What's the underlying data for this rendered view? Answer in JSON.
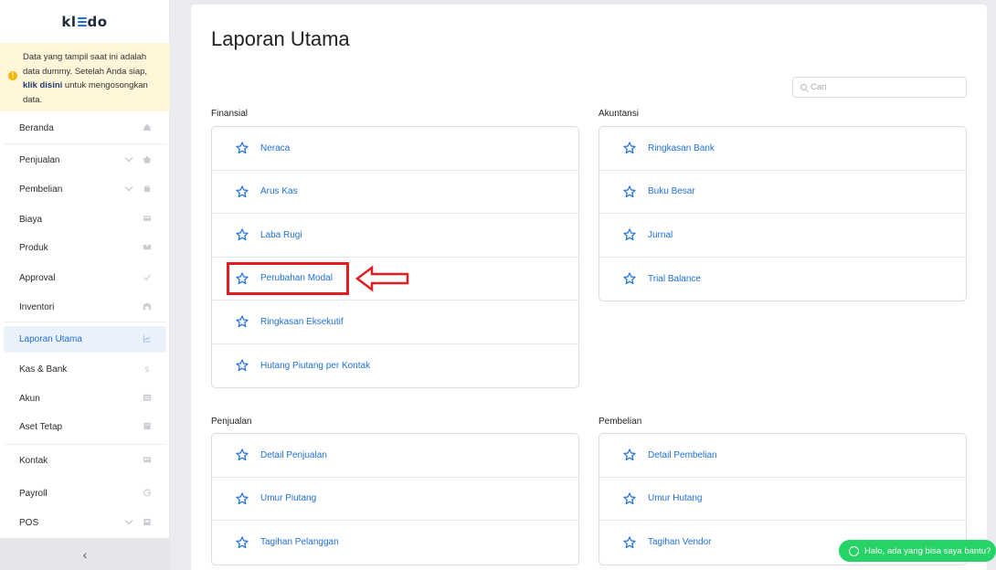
{
  "app": {
    "logo": "kledo"
  },
  "notice": {
    "line1": "Data yang tampil saat ini adalah data dummy. Setelah Anda siap, ",
    "link": "klik disini",
    "line2": " untuk mengosongkan data."
  },
  "sidebar": {
    "items": [
      {
        "label": "Beranda",
        "icon": "home-icon"
      },
      {
        "label": "Penjualan",
        "icon": "basket-icon",
        "expandable": true
      },
      {
        "label": "Pembelian",
        "icon": "bag-icon",
        "expandable": true
      },
      {
        "label": "Biaya",
        "icon": "card-icon"
      },
      {
        "label": "Produk",
        "icon": "box-icon"
      },
      {
        "label": "Approval",
        "icon": "check-icon"
      },
      {
        "label": "Inventori",
        "icon": "warehouse-icon"
      },
      {
        "label": "Laporan Utama",
        "icon": "chart-icon",
        "active": true
      },
      {
        "label": "Kas & Bank",
        "icon": "dollar-icon"
      },
      {
        "label": "Akun",
        "icon": "ledger-icon"
      },
      {
        "label": "Aset Tetap",
        "icon": "building-icon"
      },
      {
        "label": "Kontak",
        "icon": "contact-card-icon"
      },
      {
        "label": "Payroll",
        "icon": "payroll-icon"
      },
      {
        "label": "POS",
        "icon": "pos-icon",
        "expandable": true
      }
    ],
    "collapse_label": "‹"
  },
  "main": {
    "title": "Laporan Utama",
    "search_placeholder": "Cari",
    "sections": {
      "finansial": {
        "title": "Finansial",
        "items": [
          "Neraca",
          "Arus Kas",
          "Laba Rugi",
          "Perubahan Modal",
          "Ringkasan Eksekutif",
          "Hutang Piutang per Kontak"
        ]
      },
      "akuntansi": {
        "title": "Akuntansi",
        "items": [
          "Ringkasan Bank",
          "Buku Besar",
          "Jurnal",
          "Trial Balance"
        ]
      },
      "penjualan": {
        "title": "Penjualan",
        "items": [
          "Detail Penjualan",
          "Umur Piutang",
          "Tagihan Pelanggan"
        ]
      },
      "pembelian": {
        "title": "Pembelian",
        "items": [
          "Detail Pembelian",
          "Umur Hutang",
          "Tagihan Vendor"
        ]
      }
    }
  },
  "chat": {
    "label": "Halo, ada yang bisa saya bantu?"
  },
  "colors": {
    "accent": "#1e6fd9",
    "highlight": "#e11d22",
    "chat": "#25d366",
    "notice_bg": "#fff6d9"
  }
}
